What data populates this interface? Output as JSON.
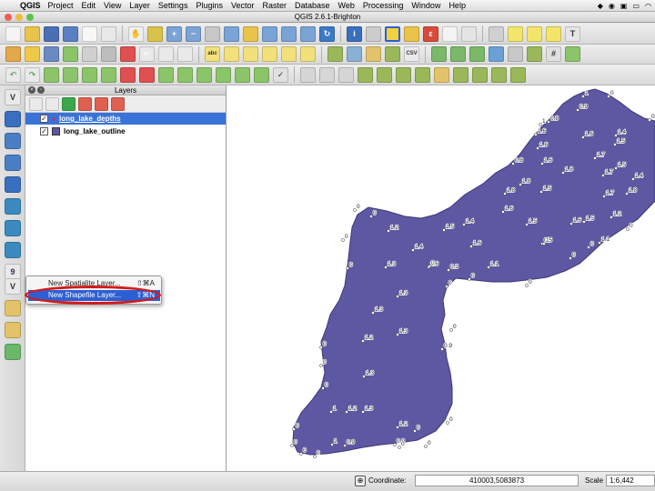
{
  "menubar": {
    "apple": "",
    "app": "QGIS",
    "items": [
      "Project",
      "Edit",
      "View",
      "Layer",
      "Settings",
      "Plugins",
      "Vector",
      "Raster",
      "Database",
      "Web",
      "Processing",
      "Window",
      "Help"
    ]
  },
  "window": {
    "title": "QGIS 2.6.1-Brighton"
  },
  "layers_panel": {
    "title": "Layers",
    "layers": [
      {
        "name": "long_lake_depths",
        "checked": true,
        "selected": true
      },
      {
        "name": "long_lake_outline",
        "checked": true,
        "selected": false
      }
    ]
  },
  "context_menu": {
    "items": [
      {
        "label": "New Spatialite Layer...",
        "shortcut": "⇧⌘A"
      },
      {
        "label": "New Shapefile Layer...",
        "shortcut": "⇧⌘N"
      }
    ]
  },
  "map": {
    "polygon_fill": "#5e57a2",
    "depth_labels": [
      "1",
      "1",
      "0.8",
      "0.9",
      "1.6",
      "1.6",
      "1.6",
      "1.4",
      "1.5",
      "1.7",
      "1.5",
      "1.4",
      "0.8",
      "1.6",
      "1.8",
      "1.7",
      "1.8",
      "1.5",
      "1.8",
      "1.8",
      "1.7",
      "1.6",
      "1.5",
      "1.5",
      "1.2",
      "1.6",
      "1.1",
      "0.5",
      "1.5",
      "1.4",
      "1.6",
      "1.4",
      "1.2",
      "1",
      "1.3",
      "1.6",
      "0.3",
      "1.1",
      "1.3",
      "1.3",
      "1.3",
      "1.2",
      "1.3",
      "0.9",
      "1.2",
      "1.3",
      "1",
      "1.2",
      "1",
      "0.9",
      "0.9",
      "0",
      "0",
      "0",
      "0",
      "0",
      "0",
      "0",
      "0",
      "0",
      "0",
      "0",
      "0",
      "0",
      "0",
      "0",
      "0",
      "0",
      "0",
      "0",
      "0",
      "0",
      "0",
      "0",
      "0",
      "0",
      "0"
    ]
  },
  "status": {
    "coordinate_label": "Coordinate:",
    "coordinate_value": "410003,5083873",
    "scale_label": "Scale",
    "scale_value": "1:6,442"
  },
  "colors": {
    "selection": "#3a73d8",
    "menu_highlight": "#2d5fd4",
    "ring": "#d21a1a",
    "outline_swatch": "#5e57a2"
  }
}
